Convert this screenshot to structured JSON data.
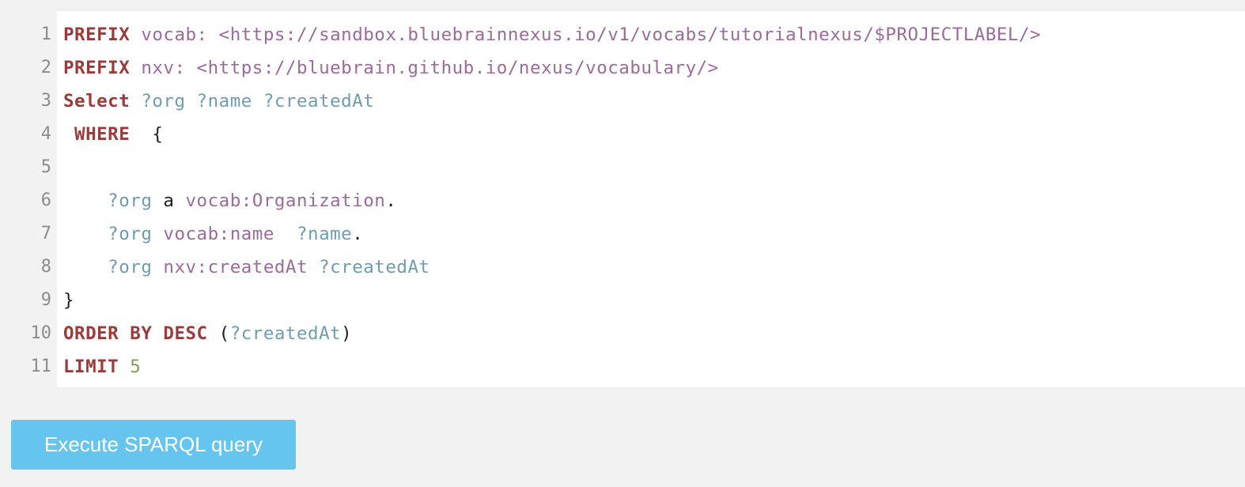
{
  "editor": {
    "line_numbers": [
      "1",
      "2",
      "3",
      "4",
      "5",
      "6",
      "7",
      "8",
      "9",
      "10",
      "11"
    ],
    "lines": [
      [
        {
          "t": "PREFIX",
          "c": "kw"
        },
        {
          "t": " vocab: <https://sandbox.bluebrainnexus.io/v1/vocabs/tutorialnexus/$PROJECTLABEL/>",
          "c": "uri"
        }
      ],
      [
        {
          "t": "PREFIX",
          "c": "kw"
        },
        {
          "t": " nxv: <https://bluebrain.github.io/nexus/vocabulary/>",
          "c": "uri"
        }
      ],
      [
        {
          "t": "Select",
          "c": "kw"
        },
        {
          "t": " ?org ?name ?createdAt",
          "c": "var"
        }
      ],
      [
        {
          "t": " WHERE",
          "c": "kw"
        },
        {
          "t": "  {",
          "c": "plain"
        }
      ],
      [],
      [
        {
          "t": "    ?org",
          "c": "var"
        },
        {
          "t": " a ",
          "c": "plain"
        },
        {
          "t": "vocab:Organization",
          "c": "uri"
        },
        {
          "t": ".",
          "c": "plain"
        }
      ],
      [
        {
          "t": "    ?org",
          "c": "var"
        },
        {
          "t": " ",
          "c": "plain"
        },
        {
          "t": "vocab:name",
          "c": "uri"
        },
        {
          "t": "  ",
          "c": "plain"
        },
        {
          "t": "?name",
          "c": "var"
        },
        {
          "t": ".",
          "c": "plain"
        }
      ],
      [
        {
          "t": "    ?org",
          "c": "var"
        },
        {
          "t": " ",
          "c": "plain"
        },
        {
          "t": "nxv:createdAt",
          "c": "uri"
        },
        {
          "t": " ",
          "c": "plain"
        },
        {
          "t": "?createdAt",
          "c": "var"
        }
      ],
      [
        {
          "t": "}",
          "c": "plain"
        }
      ],
      [
        {
          "t": "ORDER BY DESC",
          "c": "kw"
        },
        {
          "t": " (",
          "c": "plain"
        },
        {
          "t": "?createdAt",
          "c": "var"
        },
        {
          "t": ")",
          "c": "plain"
        }
      ],
      [
        {
          "t": "LIMIT",
          "c": "kw"
        },
        {
          "t": " ",
          "c": "plain"
        },
        {
          "t": "5",
          "c": "num"
        }
      ]
    ]
  },
  "run_button": {
    "label": "Execute SPARQL query"
  },
  "colors": {
    "page_background": "#f2f2f2",
    "keyword": "#9b3a3a",
    "uri": "#9a6b9a",
    "variable": "#6e9cb0",
    "plain": "#1e1e1e",
    "number": "#7e9f54",
    "line_number": "#8c8c8c",
    "button_background": "#66c5ef",
    "button_text": "#ffffff"
  }
}
